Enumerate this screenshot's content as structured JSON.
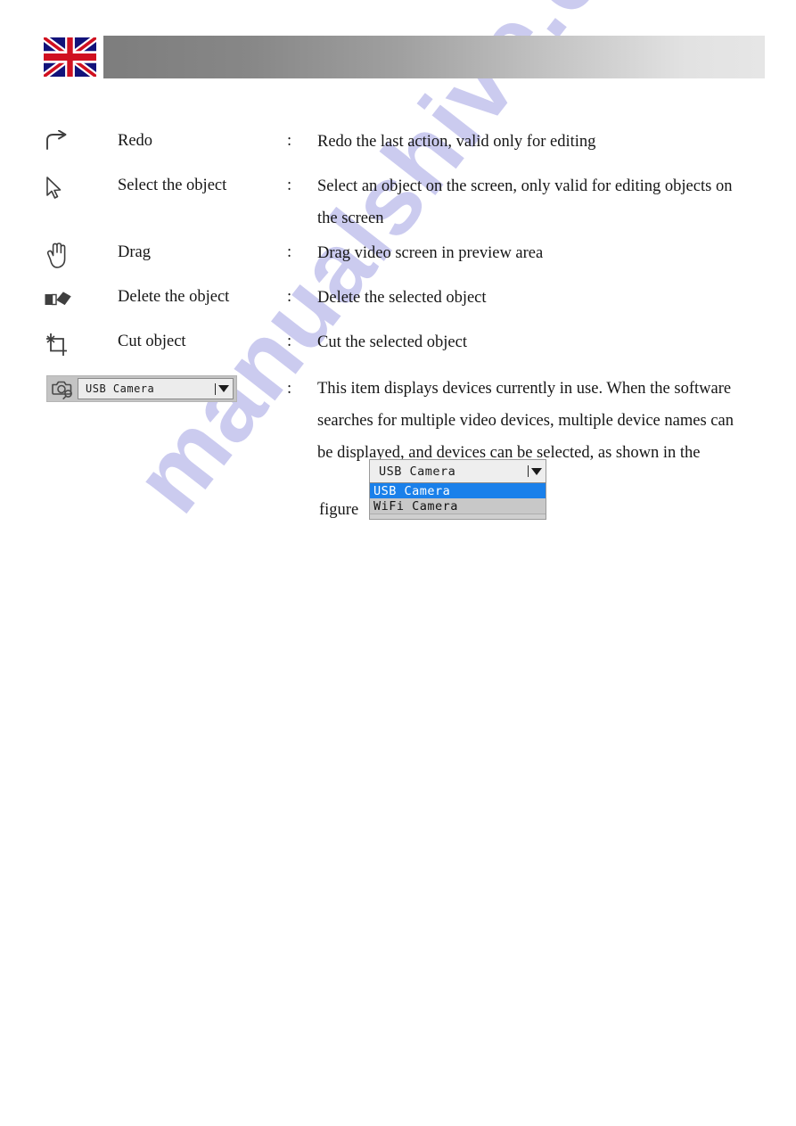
{
  "page": {
    "background_color": "#ffffff",
    "watermark_text": "manualshive.com",
    "watermark_color": "#c9c9ef"
  },
  "header": {
    "flag_name": "united-kingdom-flag",
    "bar_gradient_from": "#7d7d7d",
    "bar_gradient_to": "#e6e6e6"
  },
  "table": {
    "separator": ":",
    "rows": [
      {
        "icon": "redo-arrow-icon",
        "label": "Redo",
        "description": "Redo the last action, valid only for editing"
      },
      {
        "icon": "cursor-pointer-icon",
        "label": "Select the object",
        "description": "Select an object on the screen, only valid for editing objects on the screen"
      },
      {
        "icon": "hand-drag-icon",
        "label": "Drag",
        "description": "Drag video screen in preview area"
      },
      {
        "icon": "eraser-icon",
        "label": "Delete the object",
        "description": "Delete the selected object"
      },
      {
        "icon": "crop-icon",
        "label": "Cut object",
        "description": "Cut the selected object"
      }
    ],
    "device_row": {
      "icon": "camera-search-icon",
      "combo_value": "USB Camera",
      "separator": ":",
      "description": "This item displays devices currently in use. When the software searches for multiple video devices, multiple device names can be displayed, and devices can be selected, as shown in the"
    }
  },
  "figure": {
    "caption": "figure",
    "dropdown": {
      "selected_value": "USB Camera",
      "options": [
        {
          "label": "USB Camera",
          "selected": true
        },
        {
          "label": "WiFi Camera",
          "selected": false
        }
      ],
      "highlight_color": "#1a80ea",
      "list_background": "#c8c8c8"
    }
  }
}
